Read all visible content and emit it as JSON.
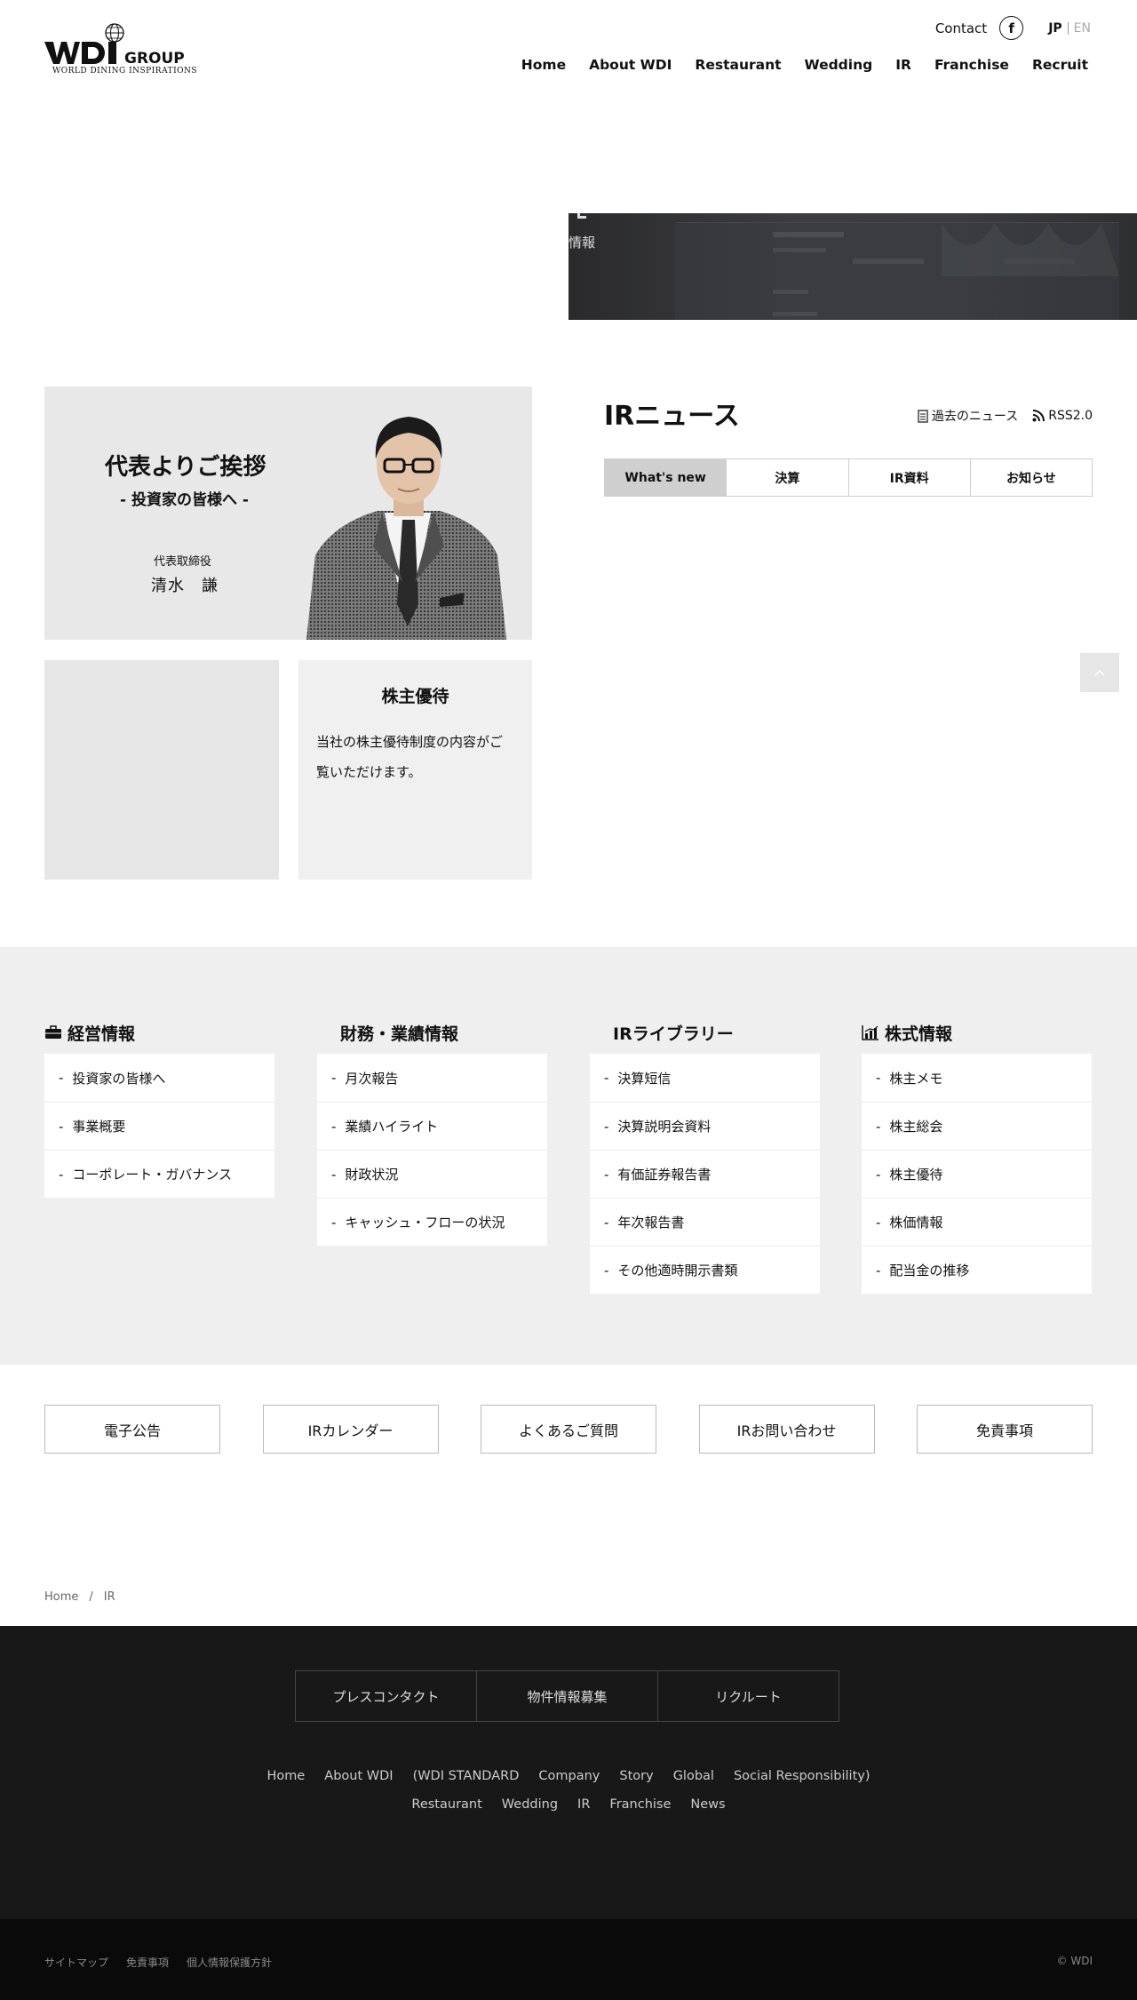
{
  "header": {
    "logo_text": "WDI GROUP",
    "logo_sub": "WORLD DINING INSPIRATIONS",
    "contact": "Contact",
    "facebook_glyph": "f",
    "lang_jp": "JP",
    "lang_en": "EN",
    "nav": [
      "Home",
      "About WDI",
      "Restaurant",
      "Wedding",
      "IR",
      "Franchise",
      "Recruit"
    ]
  },
  "hero": {
    "text": "情報"
  },
  "greeting": {
    "title": "代表よりご挨拶",
    "subtitle": "- 投資家の皆様へ -",
    "role": "代表取締役",
    "name": "清水　謙"
  },
  "yutai": {
    "title": "株主優待",
    "text": "当社の株主優待制度の内容がご覧いただけます。"
  },
  "news": {
    "title": "IRニュース",
    "past_news": "過去のニュース",
    "rss": "RSS2.0",
    "tabs": [
      "What's new",
      "決算",
      "IR資料",
      "お知らせ"
    ]
  },
  "links": {
    "columns": [
      {
        "title": "経営情報",
        "icon": "briefcase-icon",
        "items": [
          "投資家の皆様へ",
          "事業概要",
          "コーポレート・ガバナンス"
        ]
      },
      {
        "title": "財務・業績情報",
        "icon": "",
        "items": [
          "月次報告",
          "業績ハイライト",
          "財政状況",
          "キャッシュ・フローの状況"
        ]
      },
      {
        "title": "IRライブラリー",
        "icon": "",
        "items": [
          "決算短信",
          "決算説明会資料",
          "有価証券報告書",
          "年次報告書",
          "その他適時開示書類"
        ]
      },
      {
        "title": "株式情報",
        "icon": "chart-icon",
        "items": [
          "株主メモ",
          "株主総会",
          "株主優待",
          "株価情報",
          "配当金の推移"
        ]
      }
    ]
  },
  "buttons": [
    "電子公告",
    "IRカレンダー",
    "よくあるご質問",
    "IRお問い合わせ",
    "免責事項"
  ],
  "breadcrumb": {
    "home": "Home",
    "sep": "/",
    "current": "IR"
  },
  "footer": {
    "buttons": [
      "プレスコンタクト",
      "物件情報募集",
      "リクルート"
    ],
    "nav1": [
      "Home",
      "About WDI",
      "(WDI STANDARD",
      "Company",
      "Story",
      "Global",
      "Social Responsibility)"
    ],
    "nav2": [
      "Restaurant",
      "Wedding",
      "IR",
      "Franchise",
      "News"
    ],
    "bottom_links": [
      "サイトマップ",
      "免責事項",
      "個人情報保護方針"
    ],
    "copyright": "© WDI"
  }
}
